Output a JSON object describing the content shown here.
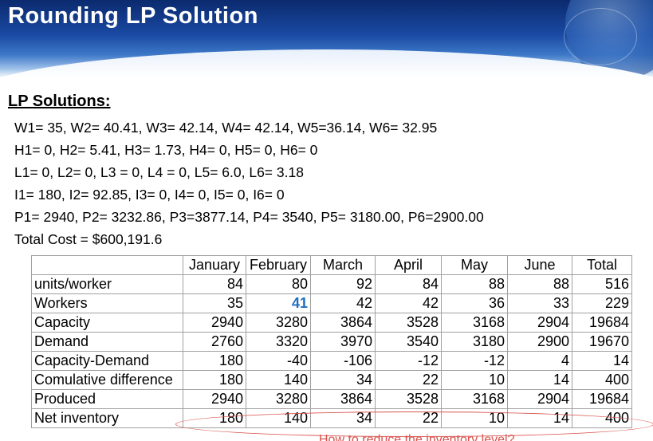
{
  "slide": {
    "title": "Rounding LP Solution",
    "subheading": "LP Solutions:",
    "lines": [
      "W1= 35, W2= 40.41, W3= 42.14, W4= 42.14, W5=36.14, W6= 32.95",
      "H1= 0, H2= 5.41, H3= 1.73, H4= 0, H5= 0, H6= 0",
      "L1= 0, L2= 0, L3 = 0, L4 = 0, L5= 6.0, L6= 3.18",
      "I1= 180, I2= 92.85, I3= 0, I4= 0, I5= 0, I6= 0",
      "P1= 2940, P2= 3232.86, P3=3877.14, P4= 3540, P5= 3180.00, P6=2900.00",
      "Total Cost = $600,191.6"
    ]
  },
  "table": {
    "headers": [
      "",
      "January",
      "February",
      "March",
      "April",
      "May",
      "June",
      "Total"
    ],
    "rows": [
      {
        "label": "units/worker",
        "cells": [
          "84",
          "80",
          "92",
          "84",
          "88",
          "88",
          "516"
        ]
      },
      {
        "label": "Workers",
        "cells": [
          "35",
          "41",
          "42",
          "42",
          "36",
          "33",
          "229"
        ]
      },
      {
        "label": "Capacity",
        "cells": [
          "2940",
          "3280",
          "3864",
          "3528",
          "3168",
          "2904",
          "19684"
        ]
      },
      {
        "label": "Demand",
        "cells": [
          "2760",
          "3320",
          "3970",
          "3540",
          "3180",
          "2900",
          "19670"
        ]
      },
      {
        "label": "Capacity-Demand",
        "cells": [
          "180",
          "-40",
          "-106",
          "-12",
          "-12",
          "4",
          "14"
        ]
      },
      {
        "label": "Comulative difference",
        "cells": [
          "180",
          "140",
          "34",
          "22",
          "10",
          "14",
          "400"
        ]
      },
      {
        "label": "Produced",
        "cells": [
          "2940",
          "3280",
          "3864",
          "3528",
          "3168",
          "2904",
          "19684"
        ]
      },
      {
        "label": "Net inventory",
        "cells": [
          "180",
          "140",
          "34",
          "22",
          "10",
          "14",
          "400"
        ]
      }
    ]
  },
  "annotation": {
    "note": "How to reduce the inventory level?",
    "color": "#d9534f",
    "highlight_color": "#1f6fc1"
  }
}
